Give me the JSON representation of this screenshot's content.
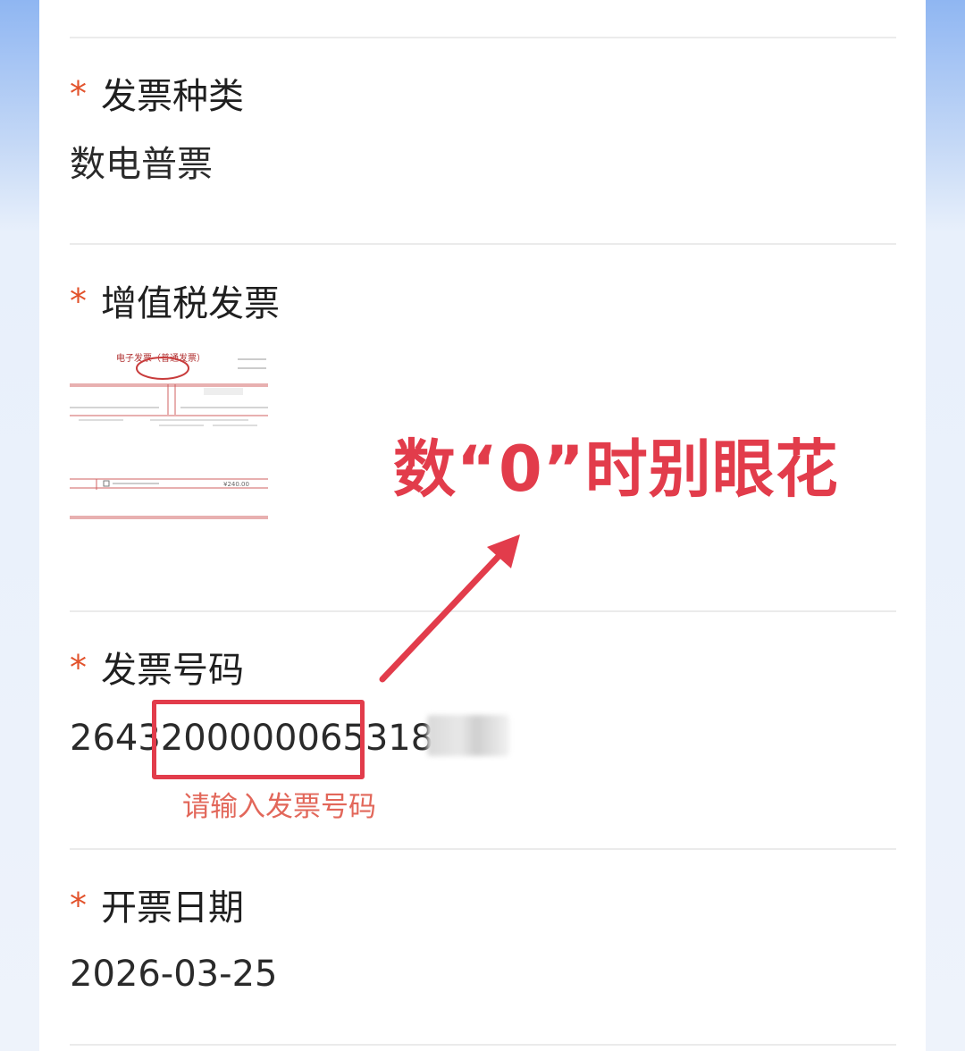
{
  "fields": [
    {
      "label": "发票种类",
      "value": "数电普票"
    },
    {
      "label": "增值税发票"
    },
    {
      "label": "发票号码",
      "value": "264320000006531841",
      "hint": "请输入发票号码"
    },
    {
      "label": "开票日期",
      "value": "2026-03-25"
    }
  ],
  "invoice_thumbnail": {
    "title": "电子发票（普通发票）",
    "total": "¥240.00"
  },
  "annotation": {
    "callout": "数“0”时别眼花",
    "color": "#e23c4b"
  },
  "required_mark": "*",
  "colors": {
    "accent": "#e2522b",
    "hint": "#e2675a",
    "card": "#ffffff"
  }
}
